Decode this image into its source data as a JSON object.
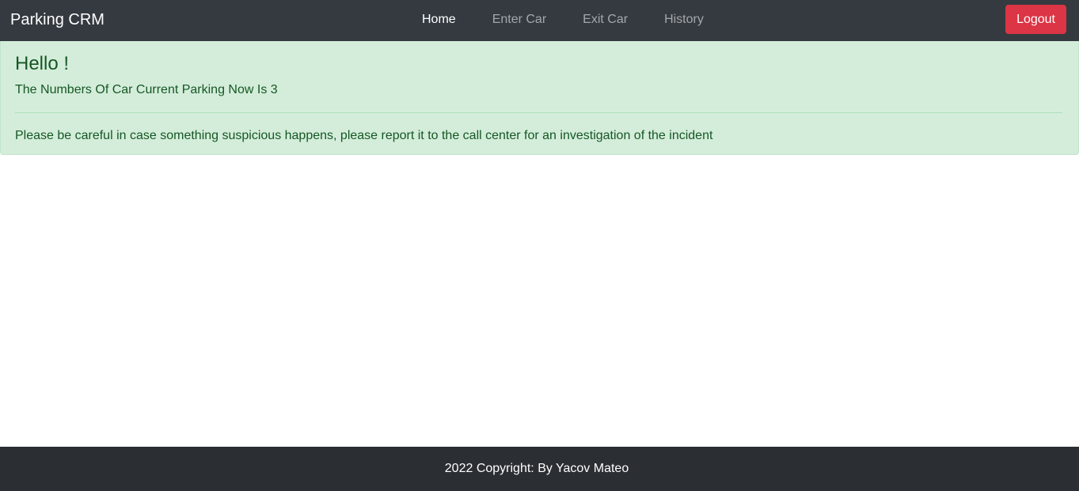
{
  "navbar": {
    "brand": "Parking CRM",
    "links": [
      {
        "label": "Home",
        "active": true
      },
      {
        "label": "Enter Car",
        "active": false
      },
      {
        "label": "Exit Car",
        "active": false
      },
      {
        "label": "History",
        "active": false
      }
    ],
    "logout_label": "Logout"
  },
  "alert": {
    "heading": "Hello !",
    "parking_count_text": "The Numbers Of Car Current Parking Now Is 3",
    "note": "Please be careful in case something suspicious happens, please report it to the call center for an investigation of the incident"
  },
  "footer": {
    "copyright": "2022 Copyright: By Yacov Mateo"
  },
  "colors": {
    "navbar_bg": "#343a40",
    "logout_bg": "#dc3545",
    "alert_bg": "#d4edda",
    "alert_text": "#155724",
    "footer_bg": "#2b2e33"
  }
}
